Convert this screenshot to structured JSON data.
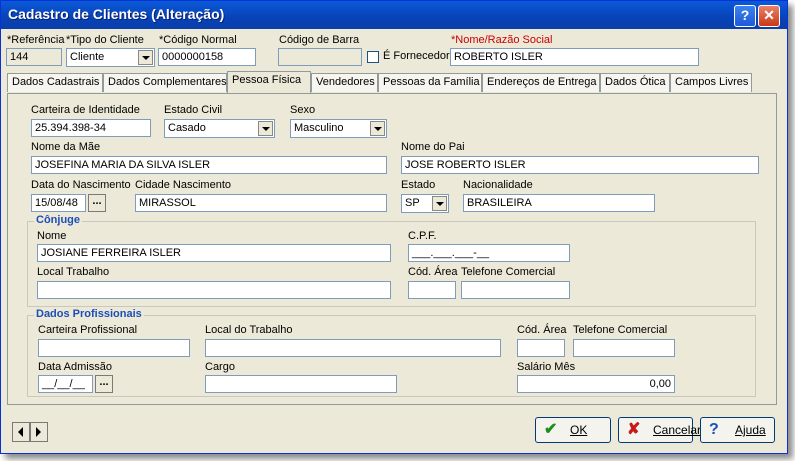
{
  "window": {
    "title": "Cadastro de Clientes (Alteração)"
  },
  "header": {
    "referencia_label": "*Referência",
    "referencia_value": "144",
    "tipo_label": "*Tipo do Cliente",
    "tipo_value": "Cliente",
    "codigo_normal_label": "*Código Normal",
    "codigo_normal_value": "0000000158",
    "codigo_barra_label": "Código de Barra",
    "codigo_barra_value": "",
    "fornecedor_label": "É Fornecedor",
    "fornecedor_checked": false,
    "nome_label": "*Nome/Razão Social",
    "nome_value": "ROBERTO ISLER"
  },
  "tabs": [
    "Dados Cadastrais",
    "Dados Complementares",
    "Pessoa Física",
    "Vendedores",
    "Pessoas da Família",
    "Endereços de Entrega",
    "Dados Ótica",
    "Campos Livres"
  ],
  "active_tab": "Pessoa Física",
  "pessoa": {
    "identidade_label": "Carteira de Identidade",
    "identidade_value": "25.394.398-34",
    "estado_civil_label": "Estado Civil",
    "estado_civil_value": "Casado",
    "sexo_label": "Sexo",
    "sexo_value": "Masculino",
    "mae_label": "Nome da Mãe",
    "mae_value": "JOSEFINA MARIA DA SILVA ISLER",
    "pai_label": "Nome do Pai",
    "pai_value": "JOSE ROBERTO ISLER",
    "nascimento_label": "Data do Nascimento",
    "nascimento_value": "15/08/48",
    "cidade_label": "Cidade Nascimento",
    "cidade_value": "MIRASSOL",
    "estado_label": "Estado",
    "estado_value": "SP",
    "nacionalidade_label": "Nacionalidade",
    "nacionalidade_value": "BRASILEIRA",
    "ellipsis": "..."
  },
  "conjuge": {
    "title": "Cônjuge",
    "nome_label": "Nome",
    "nome_value": "JOSIANE FERREIRA ISLER",
    "cpf_label": "C.P.F.",
    "cpf_value": "___.___.___-__",
    "local_label": "Local Trabalho",
    "local_value": "",
    "area_label": "Cód. Área",
    "area_value": "",
    "fone_label": "Telefone Comercial",
    "fone_value": ""
  },
  "profissional": {
    "title": "Dados Profissionais",
    "carteira_label": "Carteira Profissional",
    "carteira_value": "",
    "local_label": "Local do Trabalho",
    "local_value": "",
    "area_label": "Cód. Área",
    "area_value": "",
    "fone_label": "Telefone Comercial",
    "fone_value": "",
    "admissao_label": "Data Admissão",
    "admissao_value": "__/__/__",
    "cargo_label": "Cargo",
    "cargo_value": "",
    "salario_label": "Salário Mês",
    "salario_value": "0,00"
  },
  "buttons": {
    "ok": "OK",
    "cancel": "Cancelar",
    "help": "Ajuda",
    "help_glyph": "?",
    "close_glyph": "✕",
    "ok_glyph": "✔",
    "cancel_glyph": "✘"
  }
}
